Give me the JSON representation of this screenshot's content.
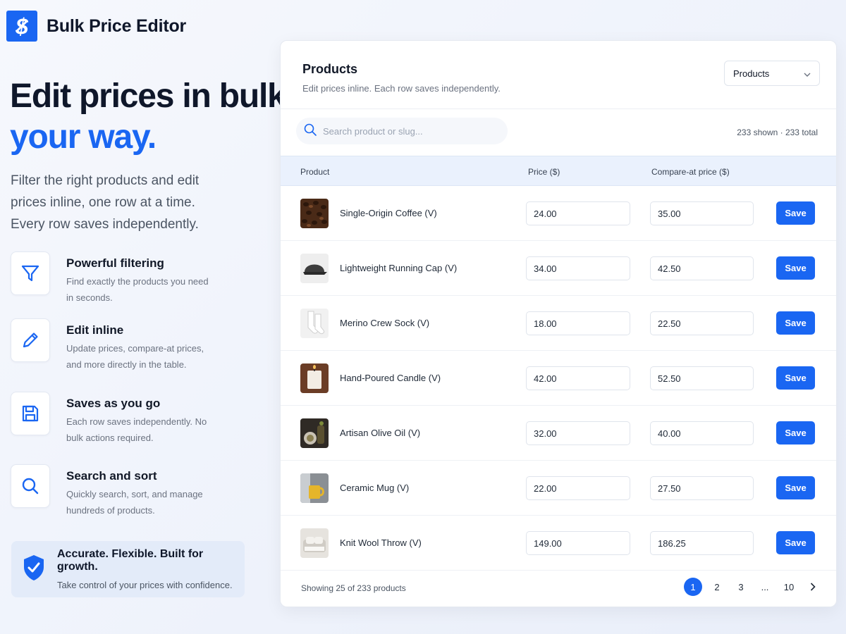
{
  "brand": {
    "name": "Bulk Price Editor"
  },
  "hero": {
    "line1": "Edit prices in bulk,",
    "line2": "your way.",
    "description": "Filter the right products and edit prices inline, one row at a time. Every row saves independently."
  },
  "features": [
    {
      "icon": "filter-icon",
      "title": "Powerful filtering",
      "desc": "Find exactly the products you need in seconds."
    },
    {
      "icon": "pencil-icon",
      "title": "Edit inline",
      "desc": "Update prices, compare-at prices, and more directly in the table."
    },
    {
      "icon": "save-icon",
      "title": "Saves as you go",
      "desc": "Each row saves independently. No bulk actions required."
    },
    {
      "icon": "search-icon",
      "title": "Search and sort",
      "desc": "Quickly search, sort, and manage hundreds of products."
    }
  ],
  "banner": {
    "icon": "shield-check-icon",
    "title": "Accurate. Flexible. Built for growth.",
    "subtitle": "Take control of your prices with confidence."
  },
  "panel": {
    "title": "Products",
    "subtitle": "Edit prices inline. Each row saves independently.",
    "select_value": "Products",
    "search_placeholder": "Search product or slug...",
    "count": "233 shown · 233 total",
    "columns": {
      "product": "Product",
      "price": "Price ($)",
      "compare": "Compare-at price ($)"
    },
    "save_label": "Save",
    "rows": [
      {
        "name": "Single-Origin Coffee (V)",
        "price": "24.00",
        "compare": "35.00",
        "thumb": "coffee"
      },
      {
        "name": "Lightweight Running Cap (V)",
        "price": "34.00",
        "compare": "42.50",
        "thumb": "cap"
      },
      {
        "name": "Merino Crew Sock (V)",
        "price": "18.00",
        "compare": "22.50",
        "thumb": "sock"
      },
      {
        "name": "Hand-Poured Candle (V)",
        "price": "42.00",
        "compare": "52.50",
        "thumb": "candle"
      },
      {
        "name": "Artisan Olive Oil (V)",
        "price": "32.00",
        "compare": "40.00",
        "thumb": "oil"
      },
      {
        "name": "Ceramic Mug (V)",
        "price": "22.00",
        "compare": "27.50",
        "thumb": "mug"
      },
      {
        "name": "Knit Wool Throw (V)",
        "price": "149.00",
        "compare": "186.25",
        "thumb": "throw"
      }
    ],
    "footer_info": "Showing 25 of 233 products",
    "pagination": {
      "pages": [
        "1",
        "2",
        "3",
        "...",
        "10"
      ],
      "active": "1",
      "next_icon": "chevron-right-icon"
    }
  },
  "colors": {
    "accent": "#1a66f2",
    "header_bg": "#eaf1fd",
    "banner_bg": "#e3ebf9"
  }
}
